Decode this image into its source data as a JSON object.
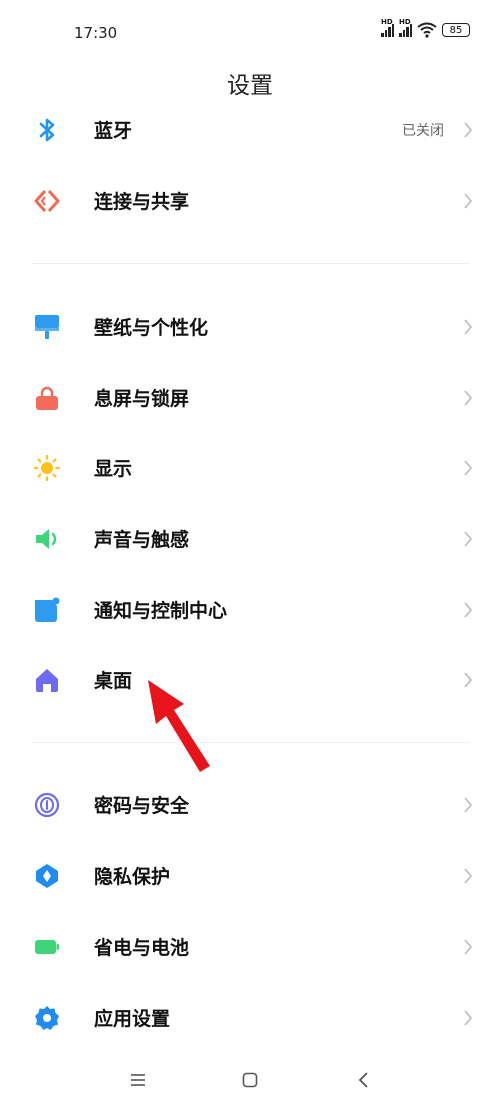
{
  "status": {
    "time": "17:30",
    "hd1": "HD",
    "hd2": "HD",
    "battery": "85"
  },
  "header": {
    "title": "设置"
  },
  "groups": [
    {
      "items": [
        {
          "label": "蓝牙",
          "value": "已关闭",
          "icon": "bluetooth-icon"
        },
        {
          "label": "连接与共享",
          "icon": "connection-share-icon"
        }
      ]
    },
    {
      "items": [
        {
          "label": "壁纸与个性化",
          "icon": "wallpaper-icon"
        },
        {
          "label": "息屏与锁屏",
          "icon": "lock-icon"
        },
        {
          "label": "显示",
          "icon": "sun-icon"
        },
        {
          "label": "声音与触感",
          "icon": "speaker-icon"
        },
        {
          "label": "通知与控制中心",
          "icon": "notification-icon"
        },
        {
          "label": "桌面",
          "icon": "home-icon"
        }
      ]
    },
    {
      "items": [
        {
          "label": "密码与安全",
          "icon": "fingerprint-icon"
        },
        {
          "label": "隐私保护",
          "icon": "privacy-icon"
        },
        {
          "label": "省电与电池",
          "icon": "battery-icon"
        },
        {
          "label": "应用设置",
          "icon": "gear-icon"
        }
      ]
    }
  ],
  "nav": {
    "menu_icon": "menu-icon",
    "home_icon": "home-square-icon",
    "back_icon": "back-icon"
  },
  "colors": {
    "bluetooth": "#2196F3",
    "connection": "#F2694F",
    "wallpaper": "#2F9BF0",
    "lock": "#F26B5B",
    "sun": "#FFC21C",
    "speaker": "#3DD47A",
    "notification": "#2F9BF0",
    "home": "#6E6BF2",
    "fingerprint": "#6E6BF2",
    "privacy": "#1E8CF0",
    "battery": "#3DD47A",
    "gear": "#1E8CF0",
    "arrow": "#E8141B"
  }
}
